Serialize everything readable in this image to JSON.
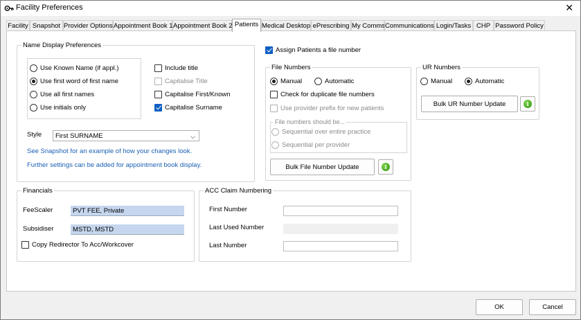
{
  "window": {
    "title": "Facility Preferences"
  },
  "tabs": [
    {
      "label": "Facility"
    },
    {
      "label": "Snapshot"
    },
    {
      "label": "Provider Options"
    },
    {
      "label": "Appointment Book 1"
    },
    {
      "label": "Appointment Book 2"
    },
    {
      "label": "Patients"
    },
    {
      "label": "Medical Desktop"
    },
    {
      "label": "ePrescribing"
    },
    {
      "label": "My Comms"
    },
    {
      "label": "Communications"
    },
    {
      "label": "Login/Tasks"
    },
    {
      "label": "CHP"
    },
    {
      "label": "Password Policy"
    }
  ],
  "active_tab": "Patients",
  "name_display": {
    "title": "Name Display Preferences",
    "radios": [
      {
        "label": "Use Known Name (if appl.)",
        "checked": false
      },
      {
        "label": "Use first word of first name",
        "checked": true
      },
      {
        "label": "Use all first names",
        "checked": false
      },
      {
        "label": "Use initials only",
        "checked": false
      }
    ],
    "checks": [
      {
        "label": "Include title",
        "checked": false,
        "disabled": false
      },
      {
        "label": "Capitalise Title",
        "checked": false,
        "disabled": true
      },
      {
        "label": "Capitalise First/Known",
        "checked": false,
        "disabled": false
      },
      {
        "label": "Capitalise Surname",
        "checked": true,
        "disabled": false
      }
    ],
    "style_label": "Style",
    "style_value": "First SURNAME",
    "link1": "See Snapshot for an example of how your changes look.",
    "link2": "Further settings can be added for appointment book display."
  },
  "assign": {
    "label": "Assign Patients a file number",
    "checked": true
  },
  "file_numbers": {
    "title": "File Numbers",
    "manual": "Manual",
    "automatic": "Automatic",
    "mode": "manual",
    "dup_check": "Check for duplicate file numbers",
    "prefix": "Use provider prefix for new patients",
    "should_be": "File numbers should be...",
    "seq_practice": "Sequential over entire practice",
    "seq_provider": "Sequential per provider",
    "bulk_button": "Bulk File Number Update"
  },
  "ur_numbers": {
    "title": "UR Numbers",
    "manual": "Manual",
    "automatic": "Automatic",
    "mode": "automatic",
    "bulk_button": "Bulk UR Number Update"
  },
  "financials": {
    "title": "Financials",
    "feescaler_label": "FeeScaler",
    "feescaler_value": "PVT FEE, Private",
    "subsidiser_label": "Subsidiser",
    "subsidiser_value": "MSTD, MSTD",
    "copy_redirector": "Copy Redirector To Acc/Workcover"
  },
  "acc": {
    "title": "ACC Claim Numbering",
    "first_label": "First Number",
    "first_value": "",
    "last_used_label": "Last Used Number",
    "last_used_value": "",
    "last_label": "Last Number",
    "last_value": ""
  },
  "footer": {
    "ok": "OK",
    "cancel": "Cancel"
  }
}
